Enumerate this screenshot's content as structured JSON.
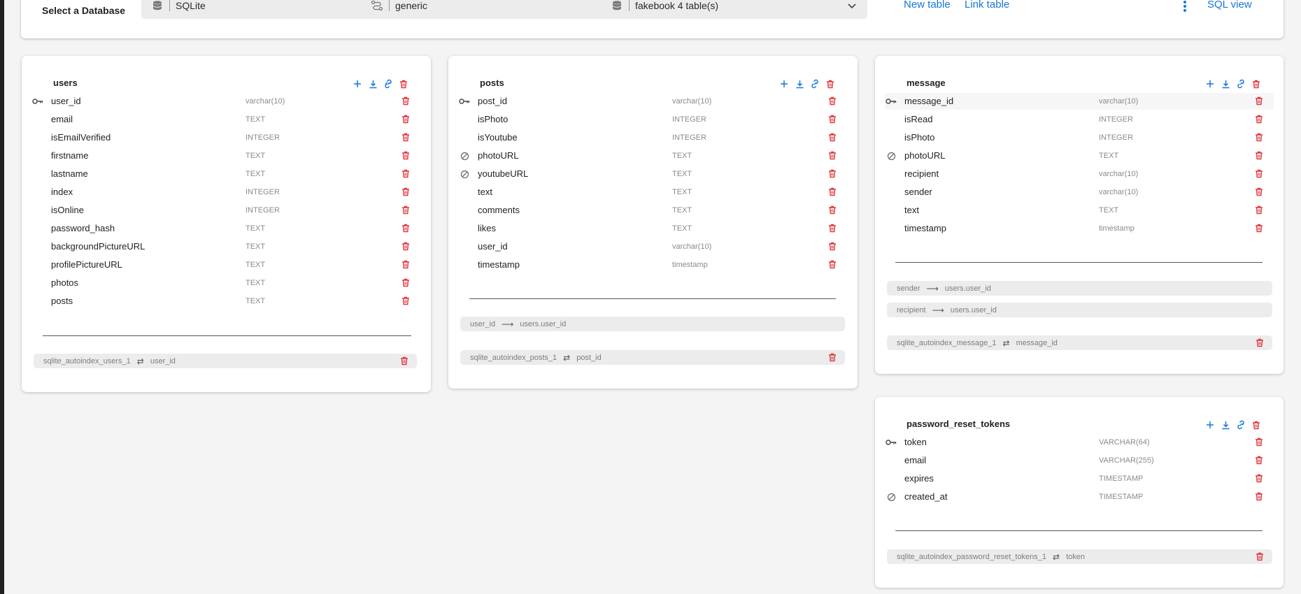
{
  "toolbar": {
    "title": "Select a Database",
    "database_value": "SQLite",
    "schema_value": "generic",
    "diagram_value": "fakebook 4 table(s)",
    "new_table": "New table",
    "link_table": "Link table",
    "sql_view": "SQL view"
  },
  "colors": {
    "accent": "#1677d9",
    "danger": "#e0383e"
  },
  "tables": {
    "users": {
      "name": "users",
      "fields": [
        {
          "name": "user_id",
          "type": "varchar(10)",
          "marker": "key"
        },
        {
          "name": "email",
          "type": "TEXT"
        },
        {
          "name": "isEmailVerified",
          "type": "INTEGER"
        },
        {
          "name": "firstname",
          "type": "TEXT"
        },
        {
          "name": "lastname",
          "type": "TEXT"
        },
        {
          "name": "index",
          "type": "INTEGER"
        },
        {
          "name": "isOnline",
          "type": "INTEGER"
        },
        {
          "name": "password_hash",
          "type": "TEXT"
        },
        {
          "name": "backgroundPictureURL",
          "type": "TEXT"
        },
        {
          "name": "profilePictureURL",
          "type": "TEXT"
        },
        {
          "name": "photos",
          "type": "TEXT"
        },
        {
          "name": "posts",
          "type": "TEXT"
        }
      ],
      "indexes": [
        {
          "name": "sqlite_autoindex_users_1",
          "column": "user_id"
        }
      ]
    },
    "posts": {
      "name": "posts",
      "fields": [
        {
          "name": "post_id",
          "type": "varchar(10)",
          "marker": "key"
        },
        {
          "name": "isPhoto",
          "type": "INTEGER"
        },
        {
          "name": "isYoutube",
          "type": "INTEGER"
        },
        {
          "name": "photoURL",
          "type": "TEXT",
          "marker": "null"
        },
        {
          "name": "youtubeURL",
          "type": "TEXT",
          "marker": "null"
        },
        {
          "name": "text",
          "type": "TEXT"
        },
        {
          "name": "comments",
          "type": "TEXT"
        },
        {
          "name": "likes",
          "type": "TEXT"
        },
        {
          "name": "user_id",
          "type": "varchar(10)"
        },
        {
          "name": "timestamp",
          "type": "timestamp"
        }
      ],
      "relations": [
        {
          "from": "user_id",
          "to": "users.user_id"
        }
      ],
      "indexes": [
        {
          "name": "sqlite_autoindex_posts_1",
          "column": "post_id"
        }
      ]
    },
    "message": {
      "name": "message",
      "fields": [
        {
          "name": "message_id",
          "type": "varchar(10)",
          "marker": "key"
        },
        {
          "name": "isRead",
          "type": "INTEGER"
        },
        {
          "name": "isPhoto",
          "type": "INTEGER"
        },
        {
          "name": "photoURL",
          "type": "TEXT",
          "marker": "null"
        },
        {
          "name": "recipient",
          "type": "varchar(10)"
        },
        {
          "name": "sender",
          "type": "varchar(10)"
        },
        {
          "name": "text",
          "type": "TEXT"
        },
        {
          "name": "timestamp",
          "type": "timestamp"
        }
      ],
      "relations": [
        {
          "from": "sender",
          "to": "users.user_id"
        },
        {
          "from": "recipient",
          "to": "users.user_id"
        }
      ],
      "indexes": [
        {
          "name": "sqlite_autoindex_message_1",
          "column": "message_id"
        }
      ]
    },
    "password_reset_tokens": {
      "name": "password_reset_tokens",
      "fields": [
        {
          "name": "token",
          "type": "VARCHAR(64)",
          "marker": "key"
        },
        {
          "name": "email",
          "type": "VARCHAR(255)"
        },
        {
          "name": "expires",
          "type": "TIMESTAMP"
        },
        {
          "name": "created_at",
          "type": "TIMESTAMP",
          "marker": "null"
        }
      ],
      "indexes": [
        {
          "name": "sqlite_autoindex_password_reset_tokens_1",
          "column": "token"
        }
      ]
    }
  }
}
